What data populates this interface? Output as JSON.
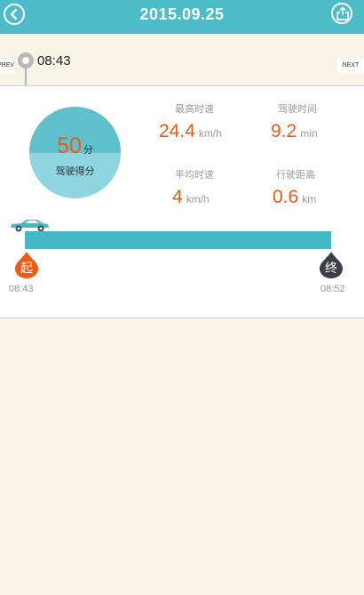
{
  "header": {
    "title": "2015.09.25"
  },
  "timeline": {
    "prev_label": "PREV",
    "next_label": "NEXT",
    "pin_time": "08:43"
  },
  "score": {
    "value": "50",
    "unit": "分",
    "label": "驾驶得分"
  },
  "stats": {
    "max_speed": {
      "label": "最高时速",
      "value": "24.4",
      "unit": "km/h"
    },
    "drive_time": {
      "label": "驾驶时间",
      "value": "9.2",
      "unit": "min"
    },
    "avg_speed": {
      "label": "平均时速",
      "value": "4",
      "unit": "km/h"
    },
    "distance": {
      "label": "行驶距离",
      "value": "0.6",
      "unit": "km"
    }
  },
  "trip": {
    "start_char": "起",
    "end_char": "终",
    "start_time": "08:43",
    "end_time": "08:52"
  },
  "colors": {
    "header_bg": "#4dbcc9",
    "accent_orange": "#f05a13",
    "bar": "#43b9c6",
    "end_marker": "#3a3f4a"
  }
}
